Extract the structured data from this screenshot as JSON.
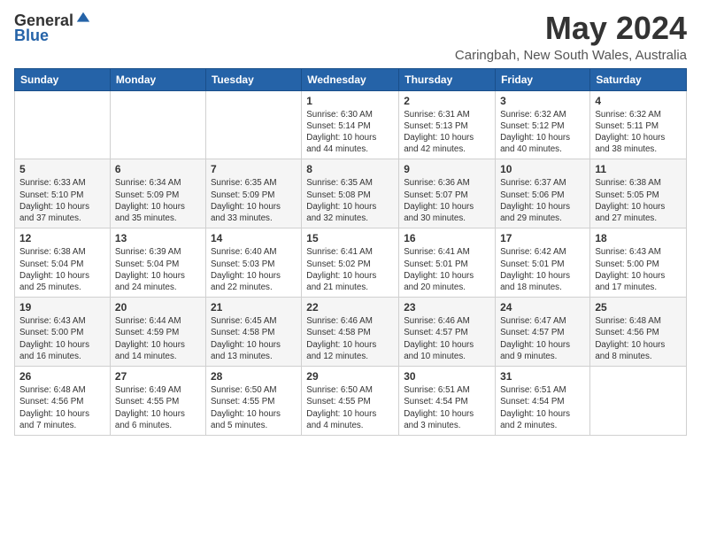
{
  "header": {
    "logo_general": "General",
    "logo_blue": "Blue",
    "month": "May 2024",
    "location": "Caringbah, New South Wales, Australia"
  },
  "days_of_week": [
    "Sunday",
    "Monday",
    "Tuesday",
    "Wednesday",
    "Thursday",
    "Friday",
    "Saturday"
  ],
  "weeks": [
    [
      {
        "day": "",
        "info": ""
      },
      {
        "day": "",
        "info": ""
      },
      {
        "day": "",
        "info": ""
      },
      {
        "day": "1",
        "info": "Sunrise: 6:30 AM\nSunset: 5:14 PM\nDaylight: 10 hours\nand 44 minutes."
      },
      {
        "day": "2",
        "info": "Sunrise: 6:31 AM\nSunset: 5:13 PM\nDaylight: 10 hours\nand 42 minutes."
      },
      {
        "day": "3",
        "info": "Sunrise: 6:32 AM\nSunset: 5:12 PM\nDaylight: 10 hours\nand 40 minutes."
      },
      {
        "day": "4",
        "info": "Sunrise: 6:32 AM\nSunset: 5:11 PM\nDaylight: 10 hours\nand 38 minutes."
      }
    ],
    [
      {
        "day": "5",
        "info": "Sunrise: 6:33 AM\nSunset: 5:10 PM\nDaylight: 10 hours\nand 37 minutes."
      },
      {
        "day": "6",
        "info": "Sunrise: 6:34 AM\nSunset: 5:09 PM\nDaylight: 10 hours\nand 35 minutes."
      },
      {
        "day": "7",
        "info": "Sunrise: 6:35 AM\nSunset: 5:09 PM\nDaylight: 10 hours\nand 33 minutes."
      },
      {
        "day": "8",
        "info": "Sunrise: 6:35 AM\nSunset: 5:08 PM\nDaylight: 10 hours\nand 32 minutes."
      },
      {
        "day": "9",
        "info": "Sunrise: 6:36 AM\nSunset: 5:07 PM\nDaylight: 10 hours\nand 30 minutes."
      },
      {
        "day": "10",
        "info": "Sunrise: 6:37 AM\nSunset: 5:06 PM\nDaylight: 10 hours\nand 29 minutes."
      },
      {
        "day": "11",
        "info": "Sunrise: 6:38 AM\nSunset: 5:05 PM\nDaylight: 10 hours\nand 27 minutes."
      }
    ],
    [
      {
        "day": "12",
        "info": "Sunrise: 6:38 AM\nSunset: 5:04 PM\nDaylight: 10 hours\nand 25 minutes."
      },
      {
        "day": "13",
        "info": "Sunrise: 6:39 AM\nSunset: 5:04 PM\nDaylight: 10 hours\nand 24 minutes."
      },
      {
        "day": "14",
        "info": "Sunrise: 6:40 AM\nSunset: 5:03 PM\nDaylight: 10 hours\nand 22 minutes."
      },
      {
        "day": "15",
        "info": "Sunrise: 6:41 AM\nSunset: 5:02 PM\nDaylight: 10 hours\nand 21 minutes."
      },
      {
        "day": "16",
        "info": "Sunrise: 6:41 AM\nSunset: 5:01 PM\nDaylight: 10 hours\nand 20 minutes."
      },
      {
        "day": "17",
        "info": "Sunrise: 6:42 AM\nSunset: 5:01 PM\nDaylight: 10 hours\nand 18 minutes."
      },
      {
        "day": "18",
        "info": "Sunrise: 6:43 AM\nSunset: 5:00 PM\nDaylight: 10 hours\nand 17 minutes."
      }
    ],
    [
      {
        "day": "19",
        "info": "Sunrise: 6:43 AM\nSunset: 5:00 PM\nDaylight: 10 hours\nand 16 minutes."
      },
      {
        "day": "20",
        "info": "Sunrise: 6:44 AM\nSunset: 4:59 PM\nDaylight: 10 hours\nand 14 minutes."
      },
      {
        "day": "21",
        "info": "Sunrise: 6:45 AM\nSunset: 4:58 PM\nDaylight: 10 hours\nand 13 minutes."
      },
      {
        "day": "22",
        "info": "Sunrise: 6:46 AM\nSunset: 4:58 PM\nDaylight: 10 hours\nand 12 minutes."
      },
      {
        "day": "23",
        "info": "Sunrise: 6:46 AM\nSunset: 4:57 PM\nDaylight: 10 hours\nand 10 minutes."
      },
      {
        "day": "24",
        "info": "Sunrise: 6:47 AM\nSunset: 4:57 PM\nDaylight: 10 hours\nand 9 minutes."
      },
      {
        "day": "25",
        "info": "Sunrise: 6:48 AM\nSunset: 4:56 PM\nDaylight: 10 hours\nand 8 minutes."
      }
    ],
    [
      {
        "day": "26",
        "info": "Sunrise: 6:48 AM\nSunset: 4:56 PM\nDaylight: 10 hours\nand 7 minutes."
      },
      {
        "day": "27",
        "info": "Sunrise: 6:49 AM\nSunset: 4:55 PM\nDaylight: 10 hours\nand 6 minutes."
      },
      {
        "day": "28",
        "info": "Sunrise: 6:50 AM\nSunset: 4:55 PM\nDaylight: 10 hours\nand 5 minutes."
      },
      {
        "day": "29",
        "info": "Sunrise: 6:50 AM\nSunset: 4:55 PM\nDaylight: 10 hours\nand 4 minutes."
      },
      {
        "day": "30",
        "info": "Sunrise: 6:51 AM\nSunset: 4:54 PM\nDaylight: 10 hours\nand 3 minutes."
      },
      {
        "day": "31",
        "info": "Sunrise: 6:51 AM\nSunset: 4:54 PM\nDaylight: 10 hours\nand 2 minutes."
      },
      {
        "day": "",
        "info": ""
      }
    ]
  ]
}
